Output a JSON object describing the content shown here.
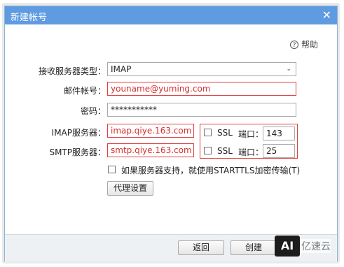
{
  "dialog": {
    "title": "新建帐号",
    "close_icon": "close-icon",
    "help_label": "帮助",
    "help_icon": "?"
  },
  "form": {
    "server_type_label": "接收服务器类型：",
    "server_type_value": "IMAP",
    "account_label": "邮件帐号：",
    "account_value": "youname@yuming.com",
    "password_label": "密码：",
    "password_value": "***********",
    "imap_label": "IMAP服务器：",
    "imap_value": "imap.qiye.163.com",
    "smtp_label": "SMTP服务器：",
    "smtp_value": "smtp.qiye.163.com",
    "ssl_label": "SSL",
    "port_label": "端口：",
    "imap_port": "143",
    "smtp_port": "25",
    "starttls_label": "如果服务器支持，就使用STARTTLS加密传输(T)",
    "proxy_button": "代理设置"
  },
  "footer": {
    "back_button": "返回",
    "create_button": "创建"
  },
  "watermark": {
    "logo": "AI",
    "text": "亿速云"
  },
  "colors": {
    "titlebar": "#5f9be0",
    "error_border": "#e04040",
    "error_text": "#d23030"
  }
}
